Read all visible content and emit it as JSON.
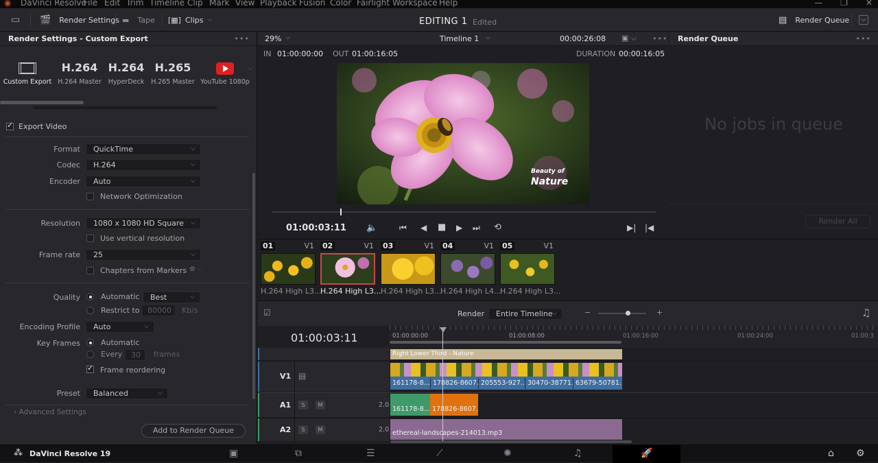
{
  "menubar": {
    "app_title": "DaVinci Resolve",
    "items": [
      "File",
      "Edit",
      "Trim",
      "Timeline",
      "Clip",
      "Mark",
      "View",
      "Playback",
      "Fusion",
      "Color",
      "Fairlight",
      "Workspace",
      "Help"
    ]
  },
  "toolbar": {
    "render_settings": "Render Settings",
    "tape": "Tape",
    "clips": "Clips",
    "project_title": "EDITING 1",
    "edited": "Edited",
    "render_queue": "Render Queue"
  },
  "render_settings": {
    "title": "Render Settings - Custom Export",
    "presets": [
      {
        "label": "Custom Export",
        "icon": "film-strip-icon"
      },
      {
        "big": "H.264",
        "label": "H.264 Master"
      },
      {
        "big": "H.264",
        "label": "HyperDeck"
      },
      {
        "big": "H.265",
        "label": "H.265 Master"
      },
      {
        "label": "YouTube 1080p",
        "icon": "youtube-icon"
      }
    ],
    "export_video": "Export Video",
    "format_label": "Format",
    "format_value": "QuickTime",
    "codec_label": "Codec",
    "codec_value": "H.264",
    "encoder_label": "Encoder",
    "encoder_value": "Auto",
    "network_opt": "Network Optimization",
    "resolution_label": "Resolution",
    "resolution_value": "1080 x 1080 HD Square",
    "vertical_res": "Use vertical resolution",
    "framerate_label": "Frame rate",
    "framerate_value": "25",
    "chapters": "Chapters from Markers",
    "quality_label": "Quality",
    "quality_auto": "Automatic",
    "quality_value": "Best",
    "restrict_to": "Restrict to",
    "restrict_value": "80000",
    "restrict_unit": "Kb/s",
    "encoding_profile_label": "Encoding Profile",
    "encoding_profile_value": "Auto",
    "keyframes_label": "Key Frames",
    "keyframes_auto": "Automatic",
    "every": "Every",
    "every_value": "30",
    "every_unit": "frames",
    "frame_reordering": "Frame reordering",
    "preset_label": "Preset",
    "preset_value": "Balanced",
    "advanced": "Advanced Settings",
    "add_button": "Add to Render Queue"
  },
  "viewer": {
    "zoom": "29%",
    "timeline_name": "Timeline 1",
    "timecode_top": "00:00:26:08",
    "in_label": "IN",
    "in_value": "01:00:00:00",
    "out_label": "OUT",
    "out_value": "01:00:16:05",
    "duration_label": "DURATION",
    "duration_value": "00:00:16:05",
    "overlay_line1": "Beauty of",
    "overlay_line2": "Nature",
    "current_tc": "01:00:03:11"
  },
  "render_queue": {
    "title": "Render Queue",
    "empty": "No jobs in queue",
    "render_all": "Render All"
  },
  "clips": [
    {
      "num": "01",
      "track": "V1",
      "caption": "H.264 High L3..."
    },
    {
      "num": "02",
      "track": "V1",
      "caption": "H.264 High L3..."
    },
    {
      "num": "03",
      "track": "V1",
      "caption": "H.264 High L3..."
    },
    {
      "num": "04",
      "track": "V1",
      "caption": "H.264 High L4..."
    },
    {
      "num": "05",
      "track": "V1",
      "caption": "H.264 High L3..."
    }
  ],
  "timeline": {
    "render_label": "Render",
    "render_value": "Entire Timeline",
    "timecode": "01:00:03:11",
    "ruler": [
      "01:00:00:00",
      "01:00:08:00",
      "01:00:16:00",
      "01:00:24:00",
      "01:00:3"
    ],
    "title_clip": "Right Lower Third - Nature",
    "v1": "V1",
    "v1_clips": [
      "161178-8...",
      "178826-8607...",
      "205553-927...",
      "30470-38771...",
      "63679-50781..."
    ],
    "a1": "A1",
    "a1_clips": [
      "161178-8...",
      "178826-8607..."
    ],
    "a2": "A2",
    "a2_clip": "ethereal-landscapes-214013.mp3",
    "audio_ch": "2.0",
    "s": "S",
    "m": "M"
  },
  "bottom": {
    "app_name": "DaVinci Resolve 19"
  },
  "colors": {
    "accent_red": "#e03a3a",
    "v1_blue": "#3f6ea0",
    "a1_green": "#3f9a6a",
    "a1_orange": "#e0720e",
    "a2_purple": "#8a6a90",
    "title_tan": "#c8b896"
  }
}
